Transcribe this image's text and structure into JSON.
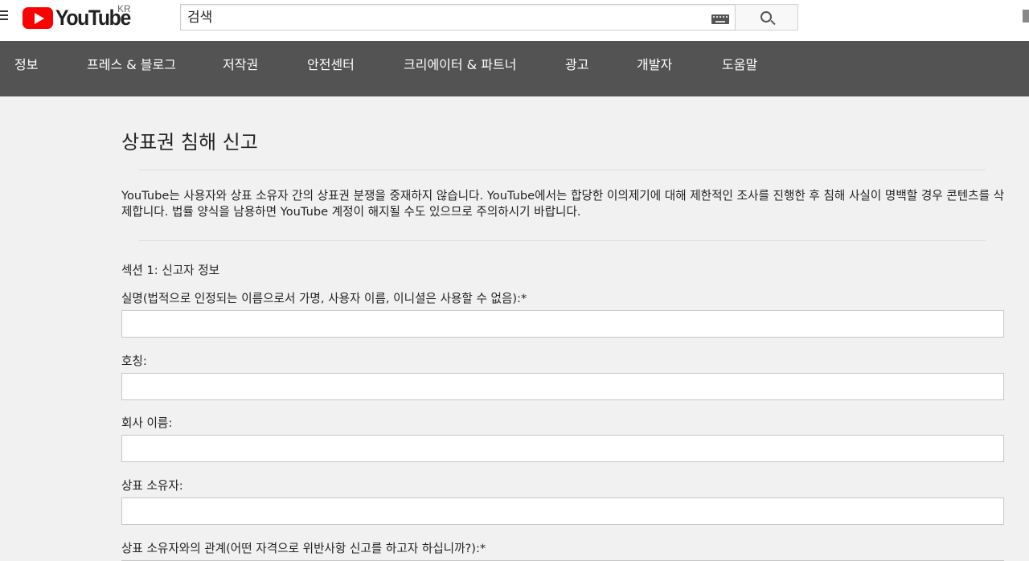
{
  "header": {
    "logo_text": "YouTube",
    "country_code": "KR",
    "search_placeholder": "검색"
  },
  "nav": {
    "items": [
      "정보",
      "프레스 & 블로그",
      "저작권",
      "안전센터",
      "크리에이터 & 파트너",
      "광고",
      "개발자",
      "도움말"
    ]
  },
  "main": {
    "title": "상표권 침해 신고",
    "intro": "YouTube는 사용자와 상표 소유자 간의 상표권 분쟁을 중재하지 않습니다. YouTube에서는 합당한 이의제기에 대해 제한적인 조사를 진행한 후 침해 사실이 명백할 경우 콘텐츠를 삭제합니다. 법률 양식을 남용하면 YouTube 계정이 해지될 수도 있으므로 주의하시기 바랍니다.",
    "section_title": "섹션 1: 신고자 정보",
    "fields": [
      {
        "label": "실명(법적으로 인정되는 이름으로서 가명, 사용자 이름, 이니셜은 사용할 수 없음):*",
        "value": ""
      },
      {
        "label": "호칭:",
        "value": ""
      },
      {
        "label": "회사 이름:",
        "value": ""
      },
      {
        "label": "상표 소유자:",
        "value": ""
      },
      {
        "label": "상표 소유자와의 관계(어떤 자격으로 위반사항 신고를 하고자 하십니까?):*",
        "value": ""
      }
    ]
  },
  "colors": {
    "nav_background": "#535353",
    "logo_red": "#ff0000",
    "page_background": "#f1f1f1"
  }
}
